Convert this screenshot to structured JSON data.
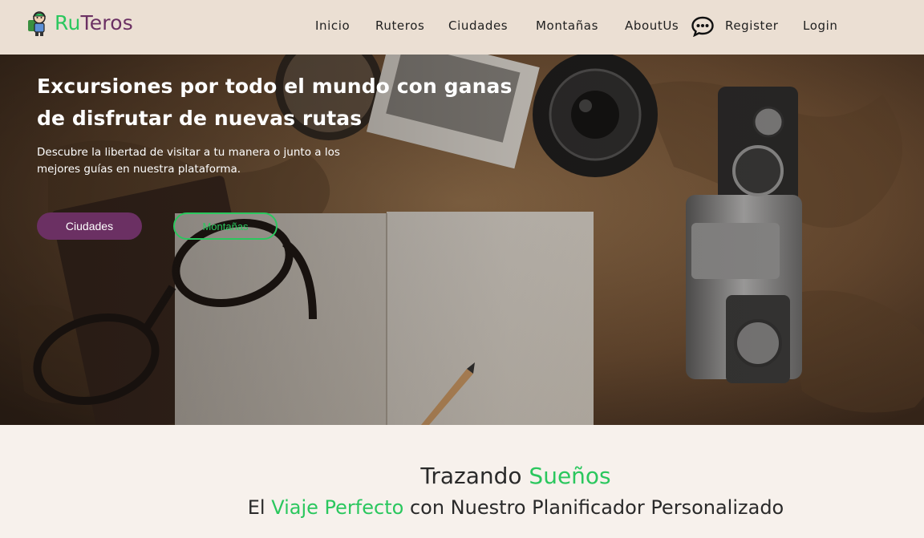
{
  "header": {
    "brand_part1": "Ru",
    "brand_part2": "Teros",
    "nav": [
      "Inicio",
      "Ruteros",
      "Ciudades",
      "Montañas",
      "AboutUs"
    ],
    "register": "Register",
    "login": "Login"
  },
  "hero": {
    "title": "Excursiones por todo el mundo con ganas de disfrutar de nuevas rutas",
    "subtitle": "Descubre la libertad de visitar a tu manera o junto a los mejores guías en nuestra plataforma.",
    "btn_cities": "Ciudades",
    "btn_mountains": "Montañas"
  },
  "section": {
    "line1_a": "Trazando ",
    "line1_b": "Sueños",
    "line2_a": "El ",
    "line2_b": "Viaje Perfecto",
    "line2_c": " con Nuestro Planificador Personalizado"
  },
  "colors": {
    "accent_green": "#2bc75e",
    "accent_purple": "#6b3063",
    "header_bg": "#ebdfd3",
    "page_bg": "#f7f1ec"
  }
}
